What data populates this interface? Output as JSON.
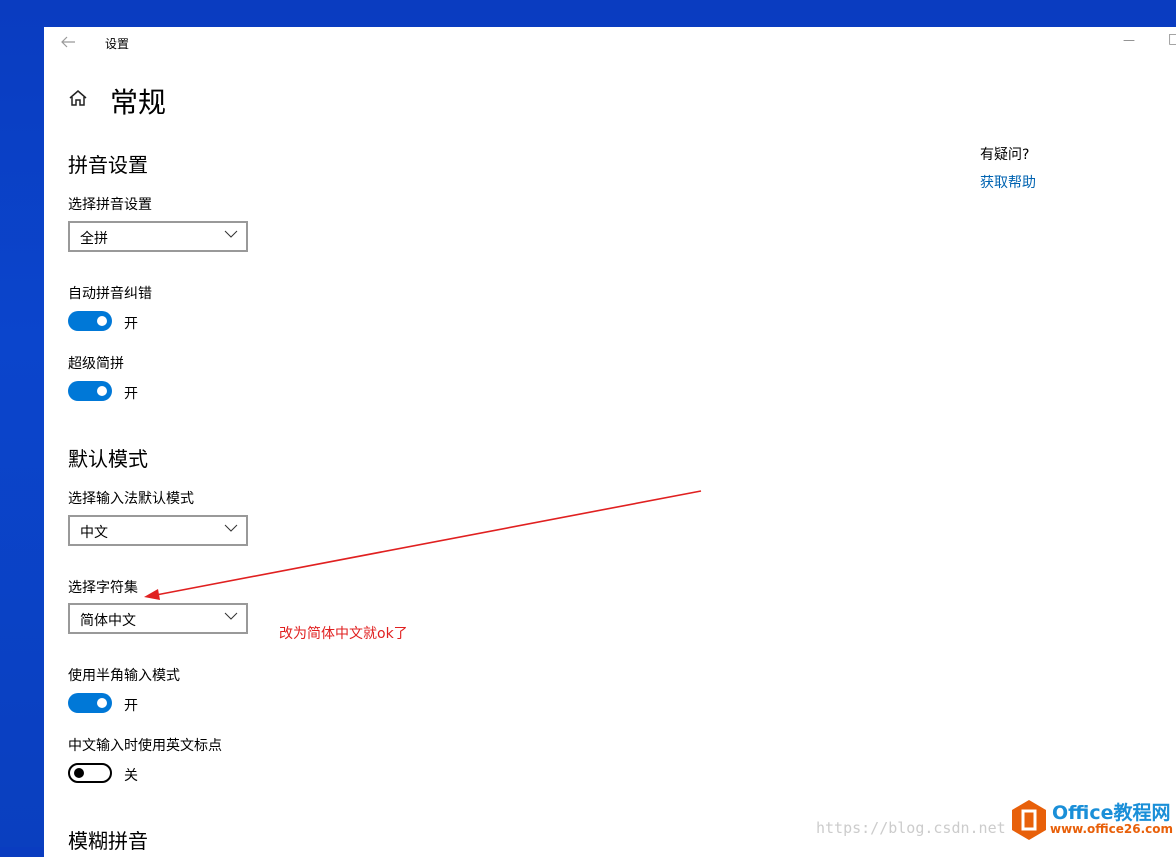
{
  "window": {
    "title": "设置",
    "minimize": "—",
    "maximize": "□"
  },
  "page": {
    "title": "常规"
  },
  "pinyin": {
    "heading": "拼音设置",
    "select_label": "选择拼音设置",
    "select_value": "全拼",
    "autocorrect": {
      "label": "自动拼音纠错",
      "state": "开",
      "on": true
    },
    "super": {
      "label": "超级简拼",
      "state": "开",
      "on": true
    }
  },
  "default_mode": {
    "heading": "默认模式",
    "mode_label": "选择输入法默认模式",
    "mode_value": "中文",
    "charset_label": "选择字符集",
    "charset_value": "简体中文",
    "halfwidth": {
      "label": "使用半角输入模式",
      "state": "开",
      "on": true
    },
    "en_punct": {
      "label": "中文输入时使用英文标点",
      "state": "关",
      "on": false
    }
  },
  "fuzzy": {
    "heading": "模糊拼音"
  },
  "help": {
    "question": "有疑问?",
    "link": "获取帮助"
  },
  "annotation": {
    "text": "改为简体中文就ok了",
    "color": "#e02020"
  },
  "watermark": {
    "url": "https://blog.csdn.net",
    "brand": "Office教程网",
    "site": "www.office26.com"
  },
  "colors": {
    "accent": "#0078d7",
    "link": "#0063b1"
  }
}
